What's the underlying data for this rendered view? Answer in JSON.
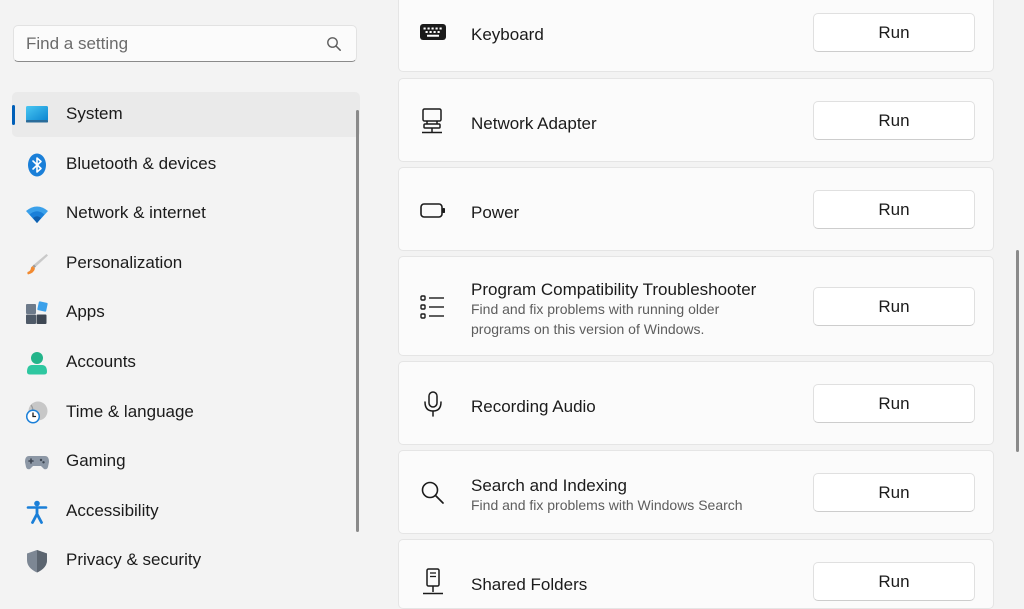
{
  "search": {
    "placeholder": "Find a setting",
    "icon": "search-icon"
  },
  "sidebar": {
    "items": [
      {
        "label": "System",
        "icon": "system-display-icon",
        "active": true
      },
      {
        "label": "Bluetooth & devices",
        "icon": "bluetooth-icon"
      },
      {
        "label": "Network & internet",
        "icon": "wifi-icon"
      },
      {
        "label": "Personalization",
        "icon": "paintbrush-icon"
      },
      {
        "label": "Apps",
        "icon": "apps-icon"
      },
      {
        "label": "Accounts",
        "icon": "account-person-icon"
      },
      {
        "label": "Time & language",
        "icon": "globe-clock-icon"
      },
      {
        "label": "Gaming",
        "icon": "gamepad-icon"
      },
      {
        "label": "Accessibility",
        "icon": "accessibility-person-icon"
      },
      {
        "label": "Privacy & security",
        "icon": "shield-icon"
      }
    ]
  },
  "troubleshooters": [
    {
      "title": "Keyboard",
      "description": "",
      "icon": "keyboard-icon",
      "button": "Run"
    },
    {
      "title": "Network Adapter",
      "description": "",
      "icon": "network-adapter-icon",
      "button": "Run"
    },
    {
      "title": "Power",
      "description": "",
      "icon": "battery-icon",
      "button": "Run"
    },
    {
      "title": "Program Compatibility Troubleshooter",
      "description_lines": [
        "Find and fix problems with running older",
        "programs on this version of Windows."
      ],
      "icon": "list-icon",
      "button": "Run"
    },
    {
      "title": "Recording Audio",
      "description": "",
      "icon": "microphone-icon",
      "button": "Run"
    },
    {
      "title": "Search and Indexing",
      "description": "Find and fix problems with Windows Search",
      "icon": "search-icon",
      "button": "Run"
    },
    {
      "title": "Shared Folders",
      "description": "",
      "icon": "shared-folder-icon",
      "button": "Run"
    }
  ],
  "colors": {
    "accent": "#005fb8",
    "window_background": "#f3f3f3",
    "card_background": "#fbfbfb",
    "active_nav_background": "#eaeaea"
  }
}
